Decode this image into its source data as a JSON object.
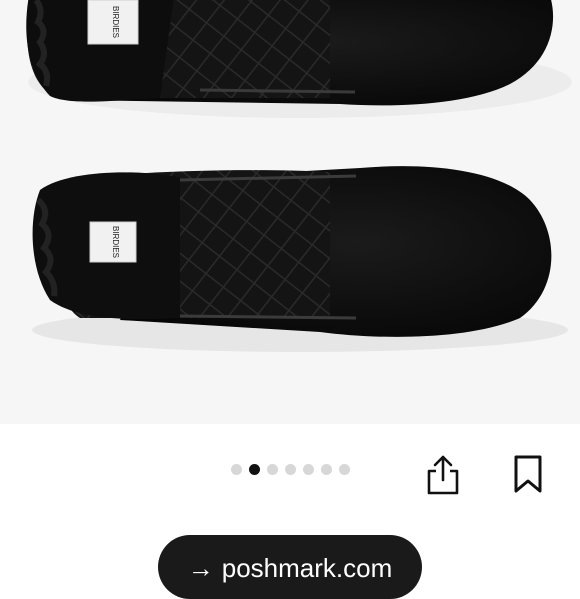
{
  "listing": {
    "image_alt": "Birdies black velvet slippers with black shearling lining",
    "brand_label_text": "BIRDIES"
  },
  "carousel": {
    "total": 7,
    "active_index": 1
  },
  "actions": {
    "share_icon": "share-icon",
    "bookmark_icon": "bookmark-icon"
  },
  "footer": {
    "arrow": "→",
    "link_text": "poshmark.com"
  },
  "colors": {
    "pill_bg": "#1a1a1a",
    "dot_active": "#111111",
    "dot_inactive": "#d7d7d7",
    "photo_bg": "#f6f6f6"
  }
}
